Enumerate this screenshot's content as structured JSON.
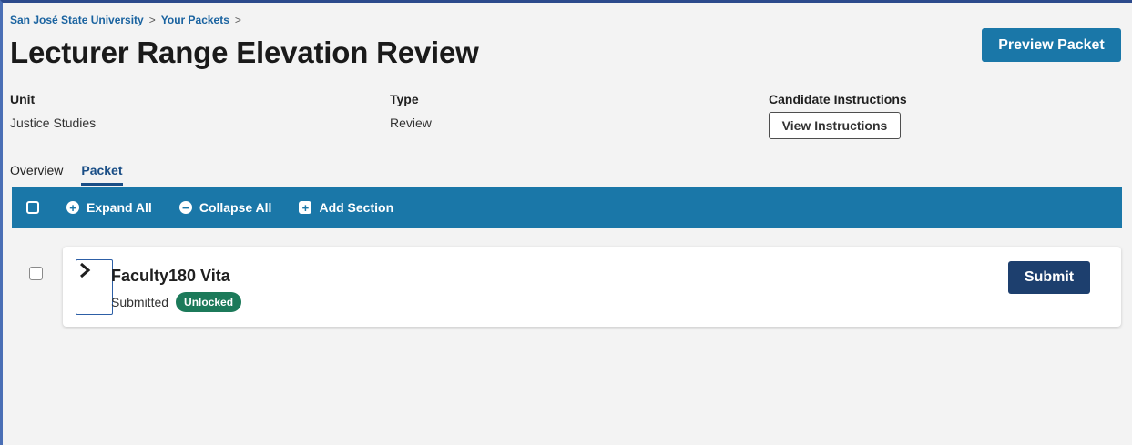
{
  "breadcrumb": {
    "items": [
      "San José State University",
      "Your Packets"
    ],
    "separator": ">"
  },
  "page": {
    "title": "Lecturer Range Elevation Review"
  },
  "header_actions": {
    "preview_label": "Preview Packet"
  },
  "meta": {
    "unit_label": "Unit",
    "unit_value": "Justice Studies",
    "type_label": "Type",
    "type_value": "Review",
    "instructions_label": "Candidate Instructions",
    "instructions_button": "View Instructions"
  },
  "tabs": [
    {
      "label": "Overview",
      "active": false
    },
    {
      "label": "Packet",
      "active": true
    }
  ],
  "toolbar": {
    "expand_all": "Expand All",
    "collapse_all": "Collapse All",
    "add_section": "Add Section"
  },
  "sections": [
    {
      "title": "Faculty180 Vita",
      "status": "Submitted",
      "badge": "Unlocked",
      "action_label": "Submit"
    }
  ],
  "colors": {
    "accent": "#1a77a8",
    "submit": "#1d3f6e",
    "badge": "#1c7a5a",
    "link": "#1a63a0"
  }
}
